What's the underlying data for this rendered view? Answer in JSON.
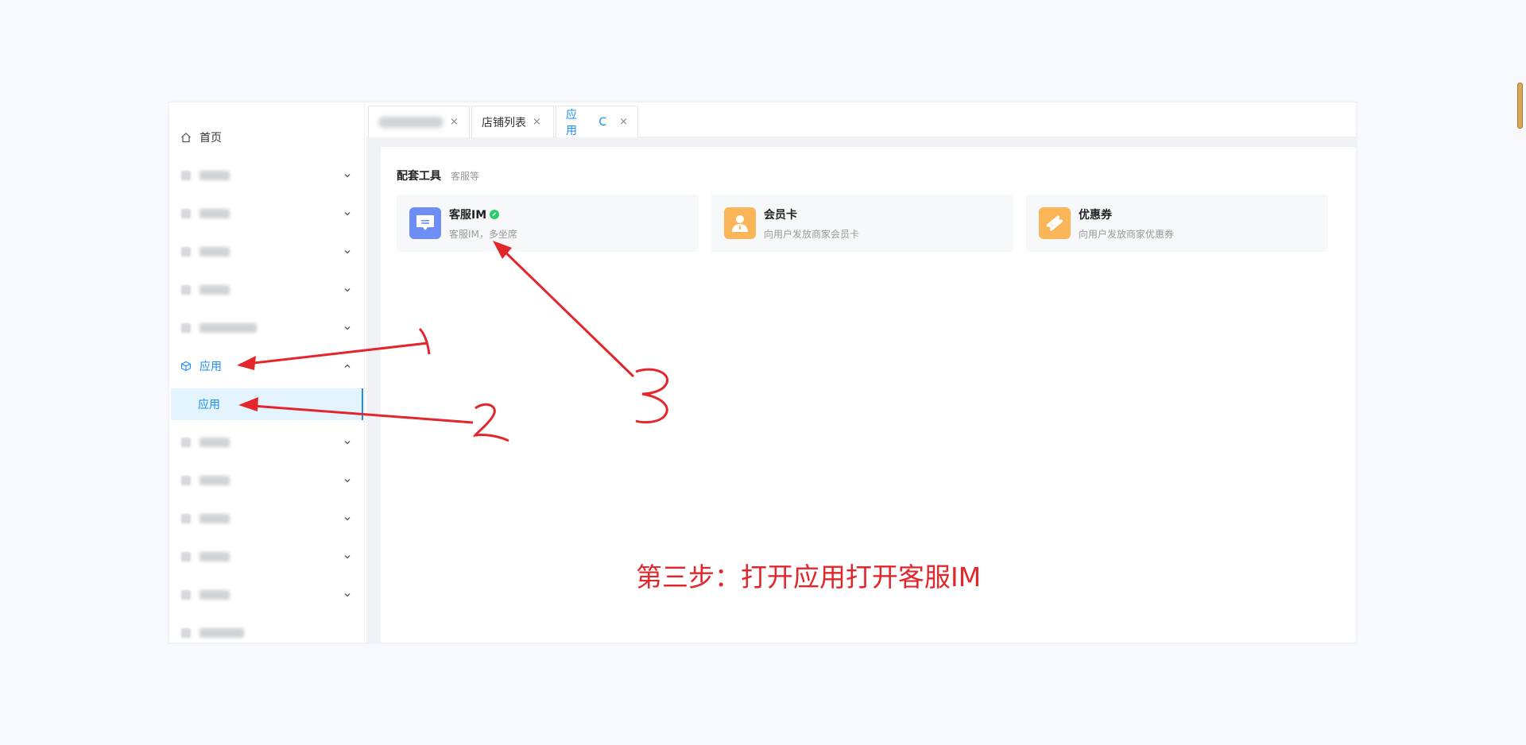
{
  "sidebar": {
    "home_label": "首页",
    "apps_parent_label": "应用",
    "apps_sub_label": "应用"
  },
  "tabs": {
    "tab2_label": "店铺列表",
    "tab3_label": "应用",
    "close_glyph": "×",
    "refresh_glyph": "C"
  },
  "content": {
    "section_title": "配套工具",
    "section_subtitle": "客服等",
    "cards": [
      {
        "title": "客服IM",
        "desc": "客服IM，多坐席",
        "icon": "chat-icon",
        "color": "#6e8ef5",
        "verified": true
      },
      {
        "title": "会员卡",
        "desc": "向用户发放商家会员卡",
        "icon": "member-icon",
        "color": "#fbb559"
      },
      {
        "title": "优惠券",
        "desc": "向用户发放商家优惠券",
        "icon": "coupon-icon",
        "color": "#fbb559"
      }
    ]
  },
  "annotation": {
    "instruction": "第三步：打开应用打开客服IM",
    "step_marks": [
      "1",
      "2",
      "3"
    ],
    "color": "#e3262b"
  },
  "colors": {
    "accent": "#1a8df5",
    "active_bg": "#e4f4fe"
  }
}
